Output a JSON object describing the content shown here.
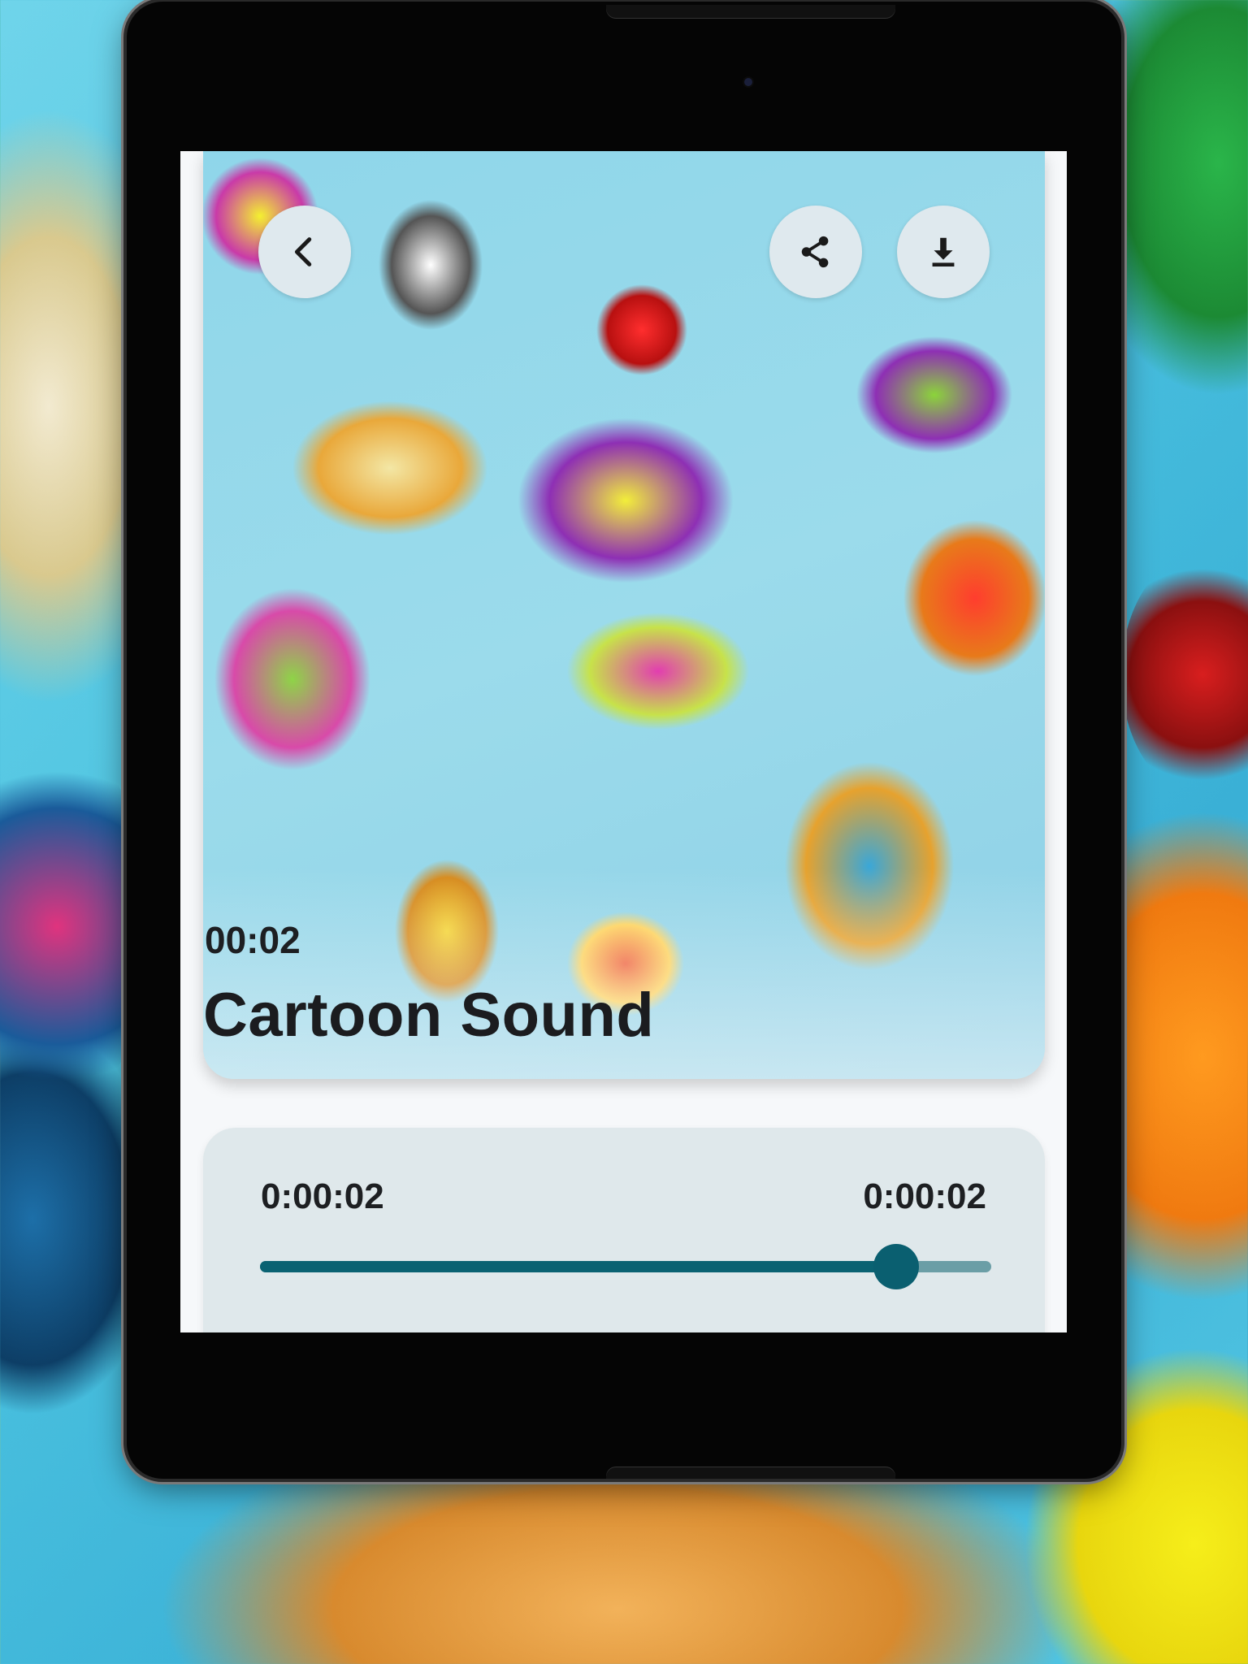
{
  "sound": {
    "duration": "00:02",
    "title": "Cartoon Sound"
  },
  "player": {
    "current_time": "0:00:02",
    "total_time": "0:00:02",
    "progress_percent": 87
  },
  "icons": {
    "back": "chevron-left-icon",
    "share": "share-icon",
    "download": "download-icon"
  },
  "colors": {
    "accent": "#0a6272",
    "button_bg": "#dfe9ee",
    "panel_bg": "#dfe8eb"
  }
}
